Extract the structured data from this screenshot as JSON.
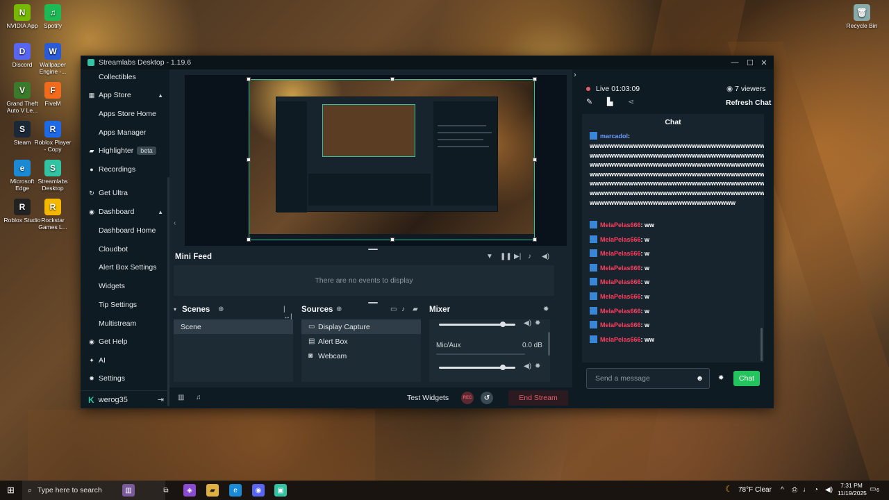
{
  "desktop": {
    "icons": [
      {
        "label": "NVIDIA App",
        "glyph": "N",
        "color": "#76b900"
      },
      {
        "label": "Spotify",
        "glyph": "♫",
        "color": "#1db954"
      },
      {
        "label": "Discord",
        "glyph": "D",
        "color": "#5865f2"
      },
      {
        "label": "Wallpaper Engine -...",
        "glyph": "W",
        "color": "#2a5bd7"
      },
      {
        "label": "Grand Theft Auto V Le...",
        "glyph": "V",
        "color": "#3b7a2a"
      },
      {
        "label": "FiveM",
        "glyph": "F",
        "color": "#f26b1d"
      },
      {
        "label": "Steam",
        "glyph": "S",
        "color": "#1b2838"
      },
      {
        "label": "Roblox Player - Copy",
        "glyph": "R",
        "color": "#1e6ae6"
      },
      {
        "label": "Microsoft Edge",
        "glyph": "e",
        "color": "#1a8ad4"
      },
      {
        "label": "Streamlabs Desktop",
        "glyph": "S",
        "color": "#31c3a2"
      },
      {
        "label": "Roblox Studio",
        "glyph": "R",
        "color": "#222"
      },
      {
        "label": "Rockstar Games L...",
        "glyph": "R",
        "color": "#f5b800"
      },
      {
        "label": "Recycle Bin",
        "glyph": "🗑",
        "color": "#8aa"
      }
    ]
  },
  "window": {
    "title": "Streamlabs Desktop - 1.19.6",
    "controls": {
      "minimize": "—",
      "maximize": "☐",
      "close": "✕"
    }
  },
  "sidebar": {
    "items": [
      {
        "label": "Collectibles",
        "icon": "",
        "sub": true
      },
      {
        "label": "App Store",
        "icon": "▦",
        "sub": false,
        "chev": "▲"
      },
      {
        "label": "Apps Store Home",
        "icon": "",
        "sub": true
      },
      {
        "label": "Apps Manager",
        "icon": "",
        "sub": true
      },
      {
        "label": "Highlighter",
        "icon": "▰",
        "sub": false,
        "badge": "beta"
      },
      {
        "label": "Recordings",
        "icon": "●",
        "sub": false
      },
      {
        "label": "Get Ultra",
        "icon": "↻",
        "sub": false
      },
      {
        "label": "Dashboard",
        "icon": "◉",
        "sub": false,
        "chev": "▲"
      },
      {
        "label": "Dashboard Home",
        "icon": "",
        "sub": true
      },
      {
        "label": "Cloudbot",
        "icon": "",
        "sub": true
      },
      {
        "label": "Alert Box Settings",
        "icon": "",
        "sub": true
      },
      {
        "label": "Widgets",
        "icon": "",
        "sub": true
      },
      {
        "label": "Tip Settings",
        "icon": "",
        "sub": true
      },
      {
        "label": "Multistream",
        "icon": "",
        "sub": true
      },
      {
        "label": "Get Help",
        "icon": "◉",
        "sub": false
      },
      {
        "label": "AI",
        "icon": "✦",
        "sub": false
      },
      {
        "label": "Settings",
        "icon": "✹",
        "sub": false
      }
    ],
    "user": "werog35",
    "logout_icon": "⇥"
  },
  "minifeed": {
    "title": "Mini Feed",
    "empty_text": "There are no events to display"
  },
  "scenes": {
    "title": "Scenes",
    "items": [
      "Scene"
    ]
  },
  "sources": {
    "title": "Sources",
    "items": [
      {
        "label": "Display Capture",
        "icon": "▭"
      },
      {
        "label": "Alert Box",
        "icon": "▤"
      },
      {
        "label": "Webcam",
        "icon": "◙"
      }
    ]
  },
  "mixer": {
    "title": "Mixer",
    "channel": "Mic/Aux",
    "db": "0.0 dB",
    "top_level": 0.84,
    "bottom_level": 0.84
  },
  "bottombar": {
    "test_widgets": "Test Widgets",
    "rec": "REC",
    "end_stream": "End Stream"
  },
  "chat": {
    "live_label": "Live",
    "live_time": "01:03:09",
    "viewers": "7 viewers",
    "refresh": "Refresh Chat",
    "header": "Chat",
    "first_user": "marcadol",
    "first_text": "wwwwwwwwwwwwwwwwwwwwwwwwwwwwwwwwwwwwwwwwwwwwwwwwwwwwwwwwwwwwwwwwwwwwwwwwwwwwwwwwwwwwwwwwwwwwwwwwwwwwwwwwwwwwwwwwwwwwwwwwwwwwwwwwwwwwwwwwwwwwwwwwwwwwwwwwwwwwwwwwwwwwwwwwwwwwwwwwwwwwwwwwwww",
    "first_lines": [
      "wwwwwwwwwwwwwwwwwwwwwwwwwwwwwwwwwwwww",
      "wwwwwwwwwwwwwwwwwwwwwwwwwwwwwwwwwwwww",
      "wwwwwwwwwwwwwwwwwwwwwwwwwwwwwwwwwwwww",
      "wwwwwwwwwwwwwwwwwwwwwwwwwwwwwwwwwwwww",
      "wwwwwwwwwwwwwwwwwwwwwwwwwwwwwwwwwwwww",
      "wwwwwwwwwwwwwwwwwwwwwwwwwwwwwwwwwwwww",
      "wwwwwwwwwwwwwwwwwwwwwwwwwwwwww"
    ],
    "messages": [
      {
        "user": "MelaPelas666",
        "text": "ww"
      },
      {
        "user": "MelaPelas666",
        "text": "w"
      },
      {
        "user": "MelaPelas666",
        "text": "w"
      },
      {
        "user": "MelaPelas666",
        "text": "w"
      },
      {
        "user": "MelaPelas666",
        "text": "w"
      },
      {
        "user": "MelaPelas666",
        "text": "w"
      },
      {
        "user": "MelaPelas666",
        "text": "w"
      },
      {
        "user": "MelaPelas666",
        "text": "w"
      },
      {
        "user": "MelaPelas666",
        "text": "ww"
      }
    ],
    "input_placeholder": "Send a message",
    "send_button": "Chat"
  },
  "taskbar": {
    "search_placeholder": "Type here to search",
    "weather": "78°F  Clear",
    "time": "7:31 PM",
    "date": "11/19/2025",
    "notifications": "6"
  },
  "colors": {
    "accent": "#31c3a2",
    "live": "#e35f6a",
    "chat_send": "#23c45e",
    "username_red": "#ff3f5f",
    "username_blue": "#6a9bff"
  }
}
